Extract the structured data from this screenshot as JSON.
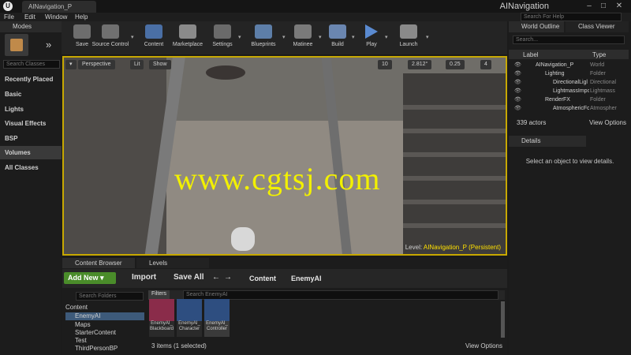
{
  "window": {
    "doc_tab": "AINavigation_P",
    "app_title": "AINavigation",
    "logo": "U"
  },
  "menu": [
    "File",
    "Edit",
    "Window",
    "Help"
  ],
  "search_help": {
    "placeholder": "Search For Help"
  },
  "modes": {
    "tab": "Modes",
    "search_placeholder": "Search Classes",
    "categories": [
      "Recently Placed",
      "Basic",
      "Lights",
      "Visual Effects",
      "BSP",
      "Volumes",
      "All Classes"
    ],
    "selected": "Volumes"
  },
  "toolbar": [
    {
      "label": "Save",
      "icon": "save-icon"
    },
    {
      "label": "Source Control",
      "icon": "source-control-icon"
    },
    {
      "label": "Content",
      "icon": "content-icon"
    },
    {
      "label": "Marketplace",
      "icon": "marketplace-icon"
    },
    {
      "label": "Settings",
      "icon": "settings-icon"
    },
    {
      "label": "Blueprints",
      "icon": "blueprints-icon"
    },
    {
      "label": "Matinee",
      "icon": "matinee-icon"
    },
    {
      "label": "Build",
      "icon": "build-icon"
    },
    {
      "label": "Play",
      "icon": "play-icon"
    },
    {
      "label": "Launch",
      "icon": "launch-icon"
    }
  ],
  "viewport": {
    "perspective": "Perspective",
    "lit": "Lit",
    "show": "Show",
    "grid_snap": "10",
    "rotation_snap": "2.812°",
    "scale_snap": "0.25",
    "camera_speed": "4",
    "level_prefix": "Level:",
    "level_name": "AINavigation_P (Persistent)",
    "watermark": "www.cgtsj.com"
  },
  "world_outliner": {
    "tab": "World Outline",
    "tab2": "Class Viewer",
    "search_placeholder": "Search...",
    "col_label": "Label",
    "col_type": "Type",
    "rows": [
      {
        "label": "AINavigation_P",
        "type": "World"
      },
      {
        "label": "Lighting",
        "type": "Folder"
      },
      {
        "label": "DirectionalLigl",
        "type": "Directional"
      },
      {
        "label": "LightmassImpo",
        "type": "Lightmass"
      },
      {
        "label": "RenderFX",
        "type": "Folder"
      },
      {
        "label": "AtmosphericFo",
        "type": "Atmospher"
      }
    ],
    "actor_count": "339 actors",
    "view_options": "View Options"
  },
  "details": {
    "tab": "Details",
    "message": "Select an object to view details."
  },
  "content_browser": {
    "tab": "Content Browser",
    "tab2": "Levels",
    "add_new": "Add New",
    "import": "Import",
    "save_all": "Save All",
    "path": [
      "Content",
      "EnemyAI"
    ],
    "folder_search": "Search Folders",
    "tree": [
      {
        "label": "Content",
        "level": 0
      },
      {
        "label": "EnemyAI",
        "level": 1
      },
      {
        "label": "Maps",
        "level": 1
      },
      {
        "label": "StarterContent",
        "level": 1
      },
      {
        "label": "Test",
        "level": 1
      },
      {
        "label": "ThirdPersonBP",
        "level": 1
      }
    ],
    "selected_folder": "EnemyAI",
    "filters": "Filters",
    "asset_search": "Search EnemyAI",
    "assets": [
      {
        "line1": "EnemyAI_",
        "line2": "Blackboard"
      },
      {
        "line1": "EnemyAI_",
        "line2": "Character"
      },
      {
        "line1": "EnemyAI_",
        "line2": "Controller"
      }
    ],
    "items_label": "3 items (1 selected)",
    "view_options": "View Options"
  },
  "colors": {
    "accent": "#c7a800",
    "add_new": "#4a8c2a",
    "watermark": "#f2f000",
    "level_name": "#ffe000"
  }
}
